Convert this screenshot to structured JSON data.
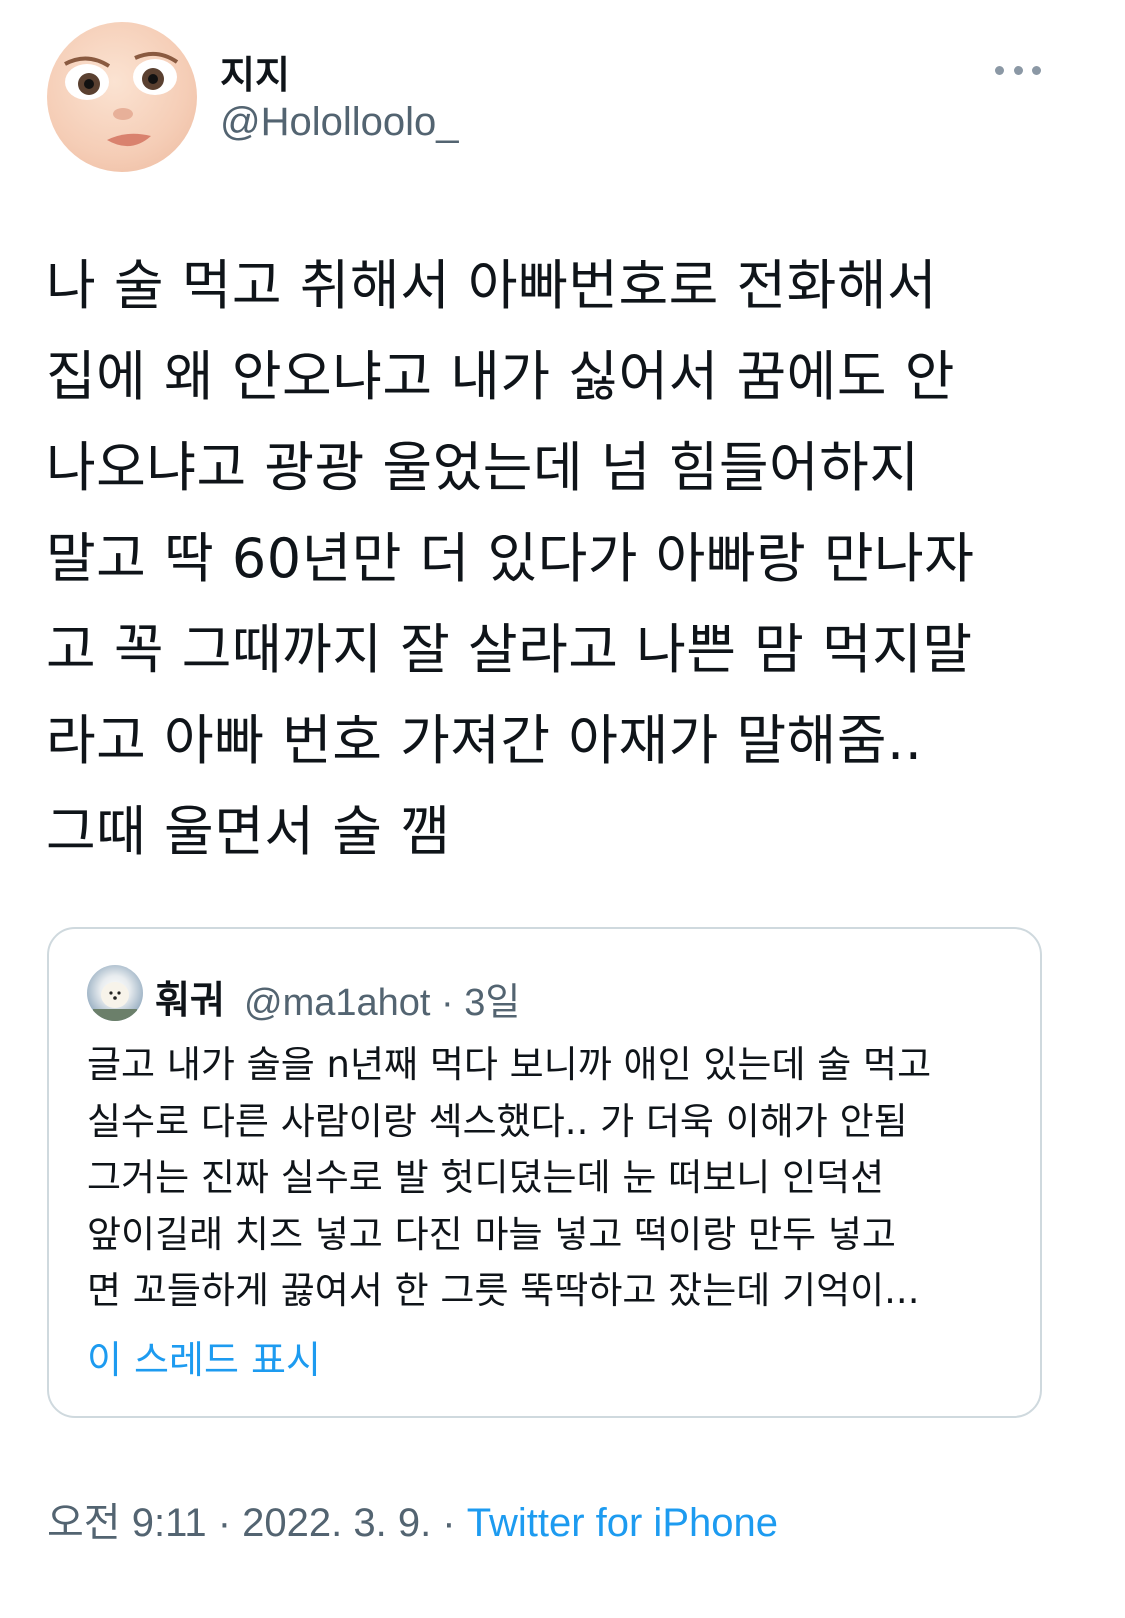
{
  "tweet": {
    "display_name": "지지",
    "handle": "@Hololloolo_",
    "text": "나 술 먹고 취해서 아빠번호로 전화해서\n집에 왜 안오냐고 내가 싫어서 꿈에도 안\n나오냐고 광광 울었는데 넘 힘들어하지\n말고 딱 60년만 더 있다가 아빠랑 만나자\n고 꼭 그때까지 잘 살라고 나쁜 맘 먹지말\n라고 아빠 번호 가져간 아재가 말해줌..\n그때 울면서 술 깸",
    "timestamp": "오전 9:11 · 2022. 3. 9. · ",
    "source": "Twitter for iPhone"
  },
  "quote": {
    "display_name": "훠궈",
    "handle_time": "@ma1ahot · 3일",
    "text": "글고 내가 술을 n년째 먹다 보니까 애인 있는데 술 먹고\n실수로 다른 사람이랑 섹스했다.. 가 더욱 이해가 안됨\n그거는 진짜 실수로 발 헛디뎠는데 눈 떠보니 인덕션\n앞이길래 치즈 넣고 다진 마늘 넣고 떡이랑 만두 넣고\n면 꼬들하게 끓여서 한 그릇 뚝딱하고 잤는데 기억이...",
    "show_thread": "이 스레드 표시"
  },
  "icons": {
    "more": "more-horizontal-icon"
  }
}
